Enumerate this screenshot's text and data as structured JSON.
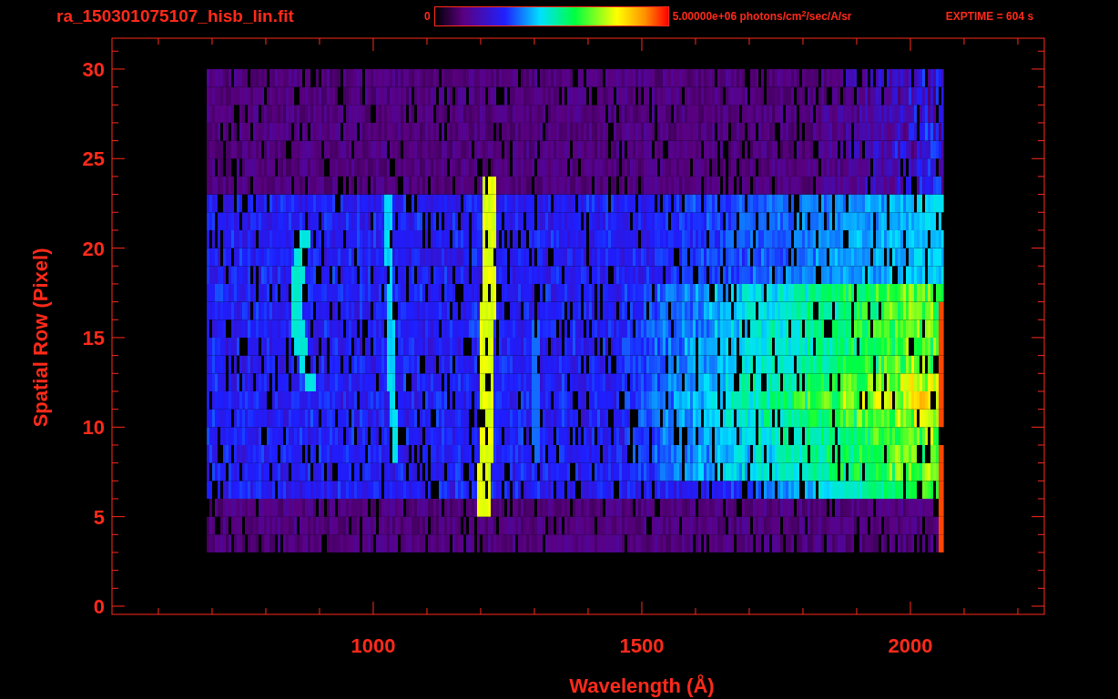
{
  "header": {
    "title": "ra_150301075107_hisb_lin.fit",
    "colorbar_min": "0",
    "colorbar_max": "5.00000e+06 photons/cm$^{2}$/sec/A/sr",
    "exptime": "EXPTIME = 604 s"
  },
  "plot": {
    "xlabel": "Wavelength (Å)",
    "ylabel": "Spatial Row (Pixel)",
    "xticks": [
      "1000",
      "1500",
      "2000"
    ],
    "yticks": [
      "30",
      "25",
      "20",
      "15",
      "10",
      "5",
      "0"
    ]
  }
}
